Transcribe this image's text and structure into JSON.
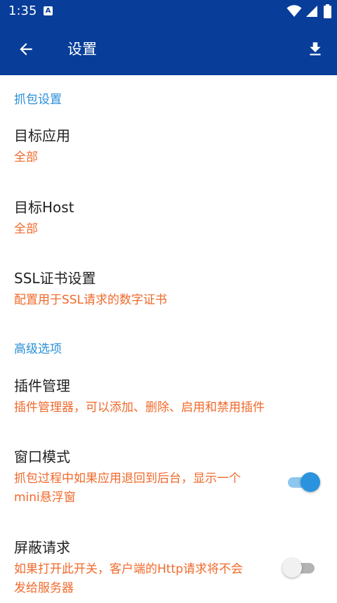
{
  "status_bar": {
    "time": "1:35",
    "notification_icon_letter": "A",
    "icons": [
      "wifi-icon",
      "cellular-icon",
      "battery-icon"
    ]
  },
  "app_bar": {
    "title": "设置",
    "back_icon": "arrow-left-icon",
    "action_icon": "download-icon"
  },
  "sections": [
    {
      "header": "抓包设置",
      "items": [
        {
          "title": "目标应用",
          "summary": "全部"
        },
        {
          "title": "目标Host",
          "summary": "全部"
        },
        {
          "title": "SSL证书设置",
          "summary": "配置用于SSL请求的数字证书"
        }
      ]
    },
    {
      "header": "高级选项",
      "items": [
        {
          "title": "插件管理",
          "summary": "插件管理器，可以添加、删除、启用和禁用插件"
        },
        {
          "title": "窗口模式",
          "summary_line1": "抓包过程中如果应用退回到后台，显示一个",
          "summary_line2": "mini悬浮窗",
          "toggle": "on"
        },
        {
          "title": "屏蔽请求",
          "summary_line1": "如果打开此开关，客户端的Http请求将不会",
          "summary_line2": "发给服务器",
          "toggle": "off"
        }
      ]
    }
  ],
  "colors": {
    "primary": "#083d99",
    "accent": "#2a8fd6",
    "summary": "#f06a2c"
  }
}
